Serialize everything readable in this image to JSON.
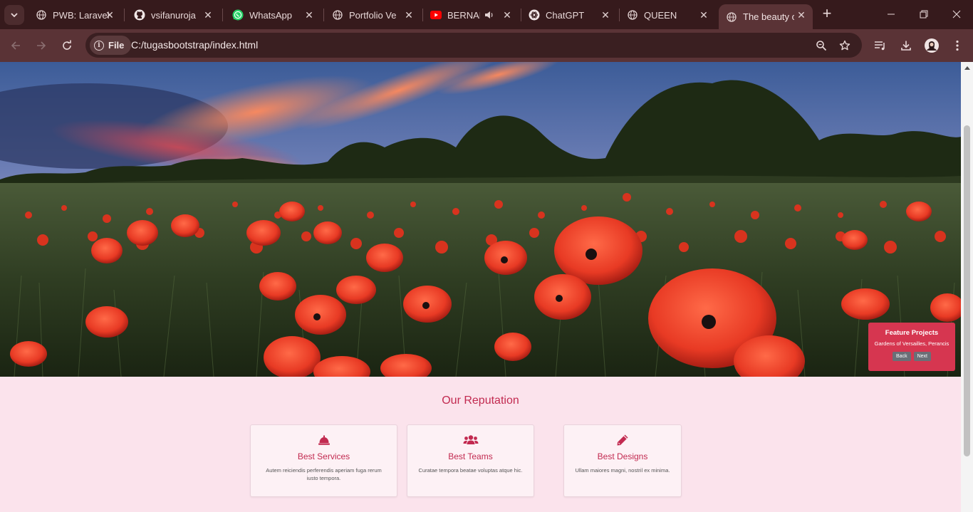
{
  "browser": {
    "tabs": [
      {
        "title": "PWB: Laravel",
        "icon": "globe-icon"
      },
      {
        "title": "vsifanuroja",
        "icon": "github-icon"
      },
      {
        "title": "WhatsApp",
        "icon": "whatsapp-icon"
      },
      {
        "title": "Portfolio Ver",
        "icon": "globe-icon"
      },
      {
        "title": "BERNAD",
        "icon": "youtube-icon",
        "audio": "speaker-icon"
      },
      {
        "title": "ChatGPT",
        "icon": "chatgpt-icon"
      },
      {
        "title": "QUEEN",
        "icon": "globe-icon"
      },
      {
        "title": "The beauty o",
        "icon": "globe-icon",
        "active": true
      }
    ],
    "new_tab": "+",
    "chip_label": "File",
    "url": "C:/tugasbootstrap/index.html"
  },
  "colors": {
    "frame": "#361a1c",
    "toolbar": "#5a3336",
    "page_bg": "#fbe3ec",
    "accent": "#c22a50",
    "feature_bg": "#d63650"
  },
  "feature": {
    "title": "Feature Projects",
    "subtitle": "Gardens of Versailles, Perancis",
    "back": "Back",
    "next": "Next"
  },
  "reputation": {
    "title": "Our Reputation",
    "cards": [
      {
        "icon": "concierge-bell-icon",
        "title": "Best Services",
        "text": "Autem reiciendis perferendis aperiam fuga rerum iusto tempora."
      },
      {
        "icon": "users-icon",
        "title": "Best Teams",
        "text": "Curatae tempora beatae voluptas atque hic."
      },
      {
        "icon": "pencil-icon",
        "title": "Best Designs",
        "text": "Ullam maiores magni, nostril ex minima."
      }
    ]
  }
}
